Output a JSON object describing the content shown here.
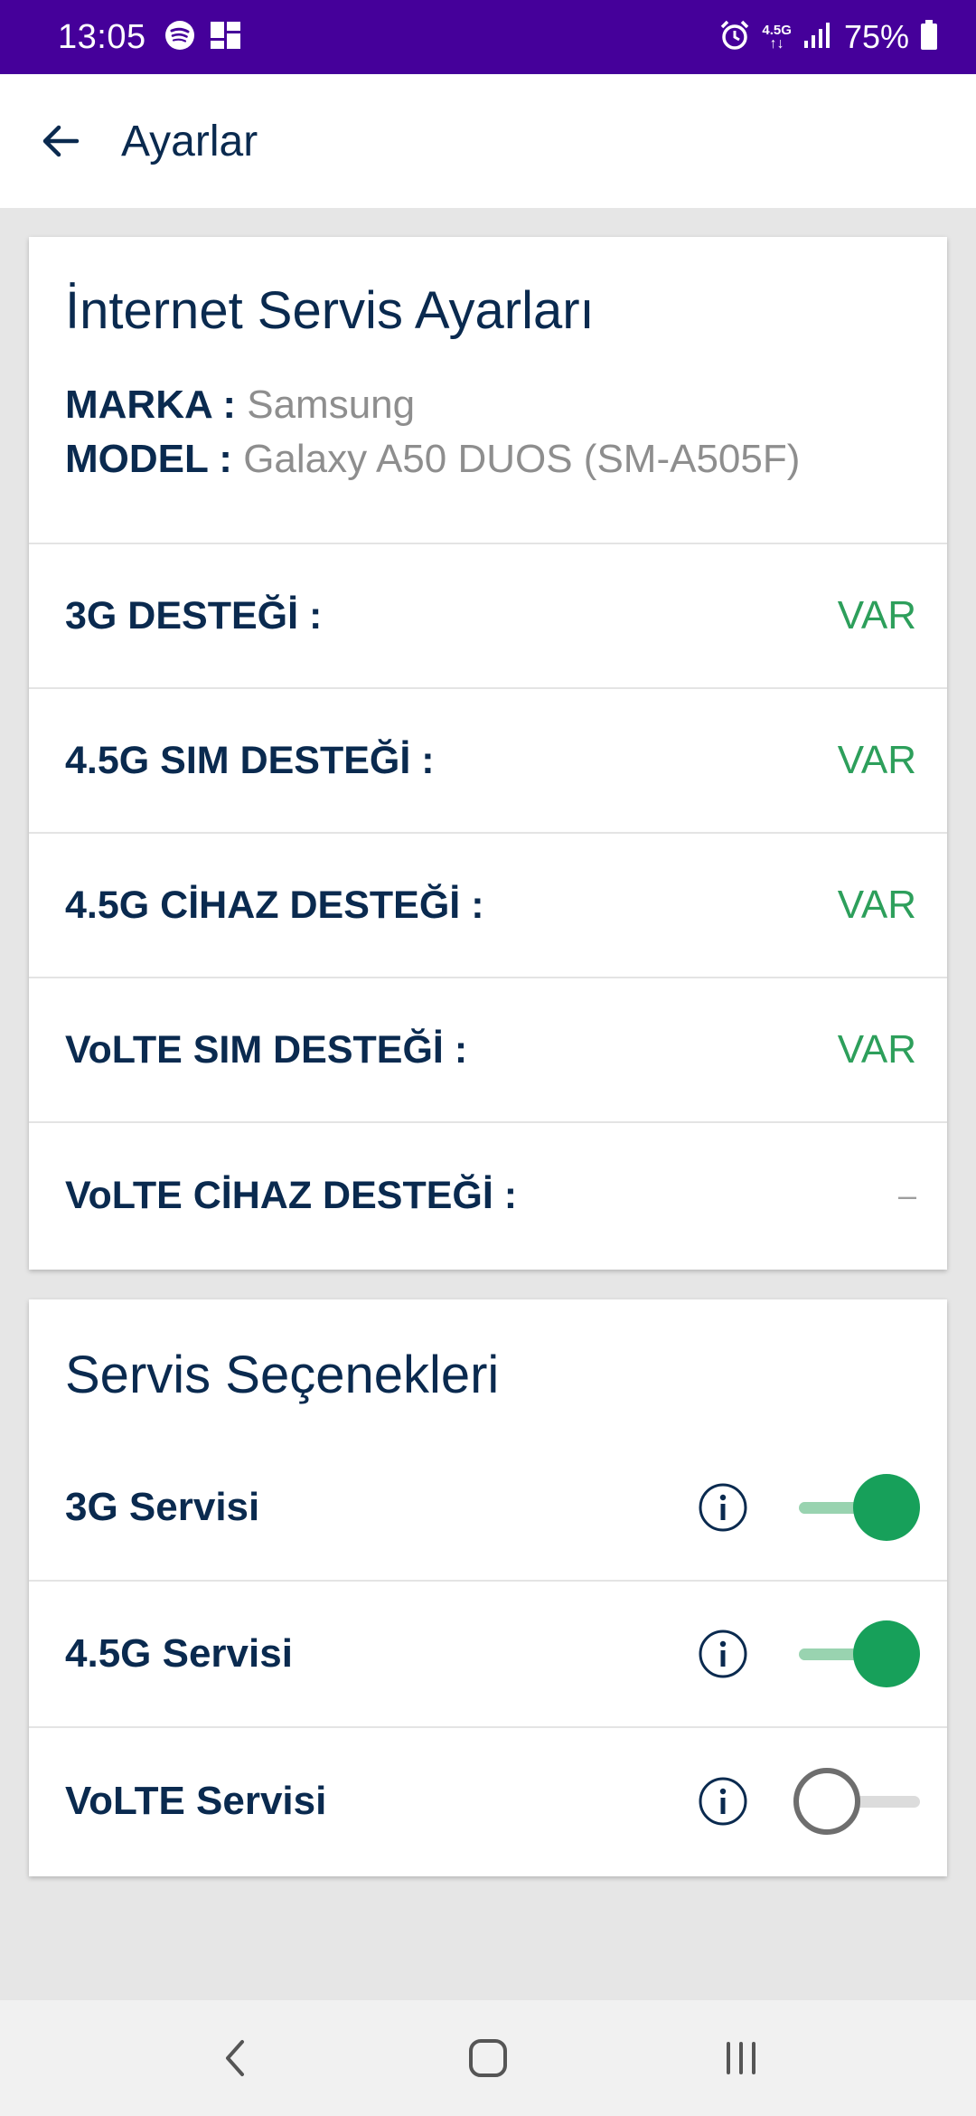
{
  "status_bar": {
    "time": "13:05",
    "network": "4.5G",
    "network_arrows": "↑↓",
    "battery": "75%",
    "icons": [
      "spotify-icon",
      "widget-icon",
      "alarm-icon",
      "network-icon",
      "signal-icon",
      "battery-icon"
    ]
  },
  "app_bar": {
    "title": "Ayarlar",
    "back_icon": "arrow-left-icon"
  },
  "internet_settings": {
    "title": "İnternet Servis Ayarları",
    "brand_label": "MARKA :",
    "brand_value": "Samsung",
    "model_label": "MODEL :",
    "model_value": "Galaxy A50 DUOS (SM-A505F)",
    "rows": [
      {
        "label": "3G DESTEĞİ :",
        "value": "VAR"
      },
      {
        "label": "4.5G SIM DESTEĞİ :",
        "value": "VAR"
      },
      {
        "label": "4.5G CİHAZ DESTEĞİ :",
        "value": "VAR"
      },
      {
        "label": "VoLTE SIM DESTEĞİ :",
        "value": "VAR"
      },
      {
        "label": "VoLTE CİHAZ DESTEĞİ :",
        "value": "–"
      }
    ]
  },
  "service_options": {
    "title": "Servis Seçenekleri",
    "rows": [
      {
        "label": "3G Servisi",
        "enabled": true
      },
      {
        "label": "4.5G Servisi",
        "enabled": true
      },
      {
        "label": "VoLTE Servisi",
        "enabled": false
      }
    ]
  },
  "colors": {
    "status_bar": "#45009a",
    "navy": "#0a2a4f",
    "available_green": "#2d9f5b",
    "toggle_on": "#17a05a",
    "toggle_on_track": "#99d3b0"
  }
}
